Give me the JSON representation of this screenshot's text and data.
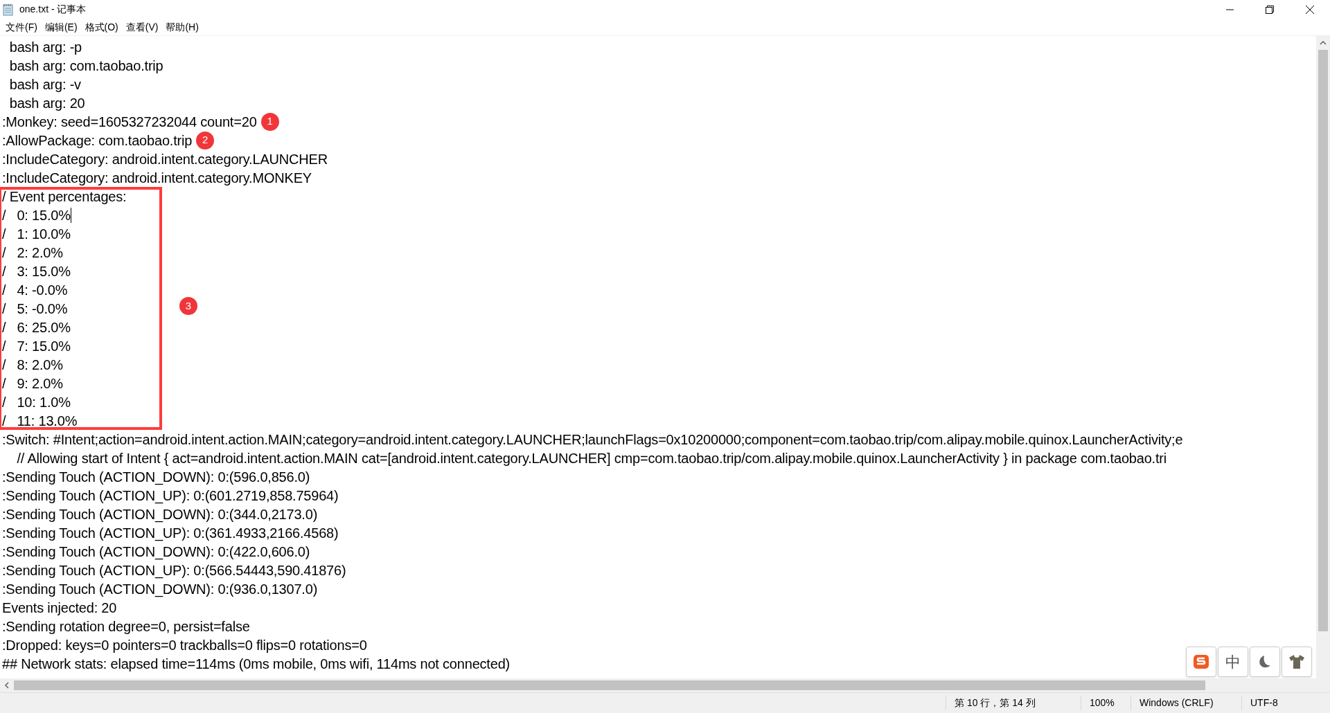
{
  "window": {
    "title": "one.txt - 记事本"
  },
  "menu": [
    "文件(F)",
    "编辑(E)",
    "格式(O)",
    "查看(V)",
    "帮助(H)"
  ],
  "lines": [
    {
      "text": "  bash arg: -p",
      "caret": false
    },
    {
      "text": "  bash arg: com.taobao.trip",
      "caret": false
    },
    {
      "text": "  bash arg: -v",
      "caret": false
    },
    {
      "text": "  bash arg: 20",
      "caret": false
    },
    {
      "text": ":Monkey: seed=1605327232044 count=20",
      "caret": false,
      "badge": "1"
    },
    {
      "text": ":AllowPackage: com.taobao.trip",
      "caret": false,
      "badge": "2"
    },
    {
      "text": ":IncludeCategory: android.intent.category.LAUNCHER",
      "caret": false
    },
    {
      "text": ":IncludeCategory: android.intent.category.MONKEY",
      "caret": false
    },
    {
      "text": "/ Event percentages:",
      "caret": false
    },
    {
      "text": "/   0: 15.0%",
      "caret": true
    },
    {
      "text": "/   1: 10.0%",
      "caret": false
    },
    {
      "text": "/   2: 2.0%",
      "caret": false
    },
    {
      "text": "/   3: 15.0%",
      "caret": false
    },
    {
      "text": "/   4: -0.0%",
      "caret": false
    },
    {
      "text": "/   5: -0.0%",
      "caret": false
    },
    {
      "text": "/   6: 25.0%",
      "caret": false
    },
    {
      "text": "/   7: 15.0%",
      "caret": false
    },
    {
      "text": "/   8: 2.0%",
      "caret": false
    },
    {
      "text": "/   9: 2.0%",
      "caret": false
    },
    {
      "text": "/   10: 1.0%",
      "caret": false
    },
    {
      "text": "/   11: 13.0%",
      "caret": false
    },
    {
      "text": ":Switch: #Intent;action=android.intent.action.MAIN;category=android.intent.category.LAUNCHER;launchFlags=0x10200000;component=com.taobao.trip/com.alipay.mobile.quinox.LauncherActivity;e",
      "caret": false
    },
    {
      "text": "    // Allowing start of Intent { act=android.intent.action.MAIN cat=[android.intent.category.LAUNCHER] cmp=com.taobao.trip/com.alipay.mobile.quinox.LauncherActivity } in package com.taobao.tri",
      "caret": false
    },
    {
      "text": ":Sending Touch (ACTION_DOWN): 0:(596.0,856.0)",
      "caret": false
    },
    {
      "text": ":Sending Touch (ACTION_UP): 0:(601.2719,858.75964)",
      "caret": false
    },
    {
      "text": ":Sending Touch (ACTION_DOWN): 0:(344.0,2173.0)",
      "caret": false
    },
    {
      "text": ":Sending Touch (ACTION_UP): 0:(361.4933,2166.4568)",
      "caret": false
    },
    {
      "text": ":Sending Touch (ACTION_DOWN): 0:(422.0,606.0)",
      "caret": false
    },
    {
      "text": ":Sending Touch (ACTION_UP): 0:(566.54443,590.41876)",
      "caret": false
    },
    {
      "text": ":Sending Touch (ACTION_DOWN): 0:(936.0,1307.0)",
      "caret": false
    },
    {
      "text": "Events injected: 20",
      "caret": false
    },
    {
      "text": ":Sending rotation degree=0, persist=false",
      "caret": false
    },
    {
      "text": ":Dropped: keys=0 pointers=0 trackballs=0 flips=0 rotations=0",
      "caret": false
    },
    {
      "text": "## Network stats: elapsed time=114ms (0ms mobile, 0ms wifi, 114ms not connected)",
      "caret": false
    }
  ],
  "annotation": {
    "badge": "3"
  },
  "status_bar": [
    "第 10 行，第 14 列",
    "100%",
    "Windows (CRLF)",
    "UTF-8"
  ],
  "ime": {
    "mode": "中"
  }
}
